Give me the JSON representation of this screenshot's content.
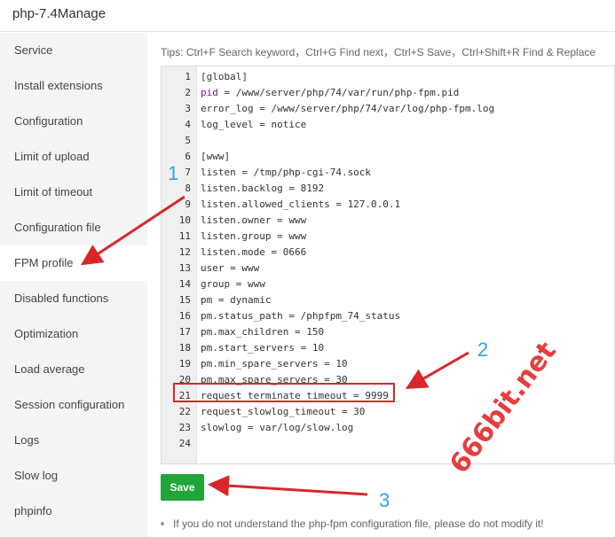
{
  "header": {
    "title": "php-7.4Manage"
  },
  "sidebar": {
    "items": [
      {
        "label": "Service"
      },
      {
        "label": "Install extensions"
      },
      {
        "label": "Configuration"
      },
      {
        "label": "Limit of upload"
      },
      {
        "label": "Limit of timeout"
      },
      {
        "label": "Configuration file"
      },
      {
        "label": "FPM profile",
        "active": true
      },
      {
        "label": "Disabled functions"
      },
      {
        "label": "Optimization"
      },
      {
        "label": "Load average"
      },
      {
        "label": "Session configuration"
      },
      {
        "label": "Logs"
      },
      {
        "label": "Slow log"
      },
      {
        "label": "phpinfo"
      }
    ]
  },
  "tips": "Tips:  Ctrl+F Search keyword，Ctrl+G Find next，Ctrl+S Save，Ctrl+Shift+R Find & Replace",
  "editor": {
    "lines": [
      "[global]",
      "pid = /www/server/php/74/var/run/php-fpm.pid",
      "error_log = /www/server/php/74/var/log/php-fpm.log",
      "log_level = notice",
      "",
      "[www]",
      "listen = /tmp/php-cgi-74.sock",
      "listen.backlog = 8192",
      "listen.allowed_clients = 127.0.0.1",
      "listen.owner = www",
      "listen.group = www",
      "listen.mode = 0666",
      "user = www",
      "group = www",
      "pm = dynamic",
      "pm.status_path = /phpfpm_74_status",
      "pm.max_children = 150",
      "pm.start_servers = 10",
      "pm.min_spare_servers = 10",
      "pm.max_spare_servers = 30",
      "request_terminate_timeout = 9999",
      "request_slowlog_timeout = 30",
      "slowlog = var/log/slow.log",
      ""
    ],
    "line_numbers": [
      "1",
      "2",
      "3",
      "4",
      "5",
      "6",
      "7",
      "8",
      "9",
      "10",
      "11",
      "12",
      "13",
      "14",
      "15",
      "16",
      "17",
      "18",
      "19",
      "20",
      "21",
      "22",
      "23",
      "24"
    ]
  },
  "save_button": {
    "label": "Save"
  },
  "note": "If you do not understand the php-fpm configuration file, please do not modify it!",
  "annotations": {
    "step1": "1",
    "step2": "2",
    "step3": "3"
  },
  "watermark": "666bit.net",
  "colors": {
    "accent_green": "#20a53a",
    "annotation_red": "#d9262b",
    "annotation_blue": "#2aa6e6"
  }
}
